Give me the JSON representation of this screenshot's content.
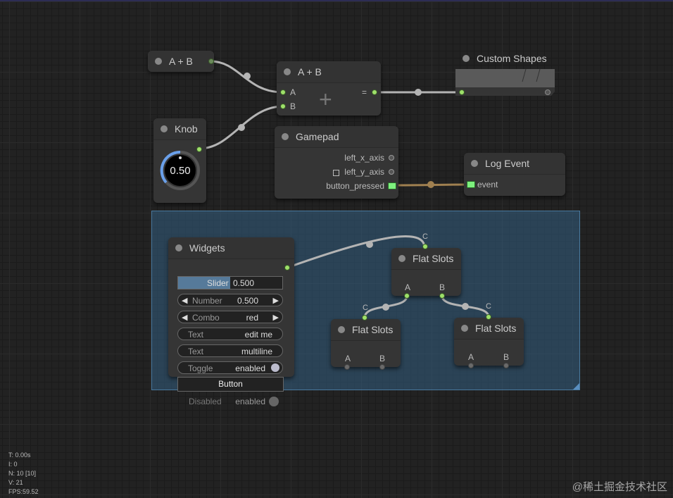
{
  "nodes": {
    "sum_collapsed": {
      "title": "A + B"
    },
    "sum": {
      "title": "A + B",
      "input_a": "A",
      "input_b": "B",
      "output": "=",
      "symbol": "+"
    },
    "custom_shapes": {
      "title": "Custom Shapes"
    },
    "knob": {
      "title": "Knob",
      "value": "0.50"
    },
    "gamepad": {
      "title": "Gamepad",
      "outputs": [
        "left_x_axis",
        "left_y_axis",
        "button_pressed"
      ]
    },
    "log_event": {
      "title": "Log Event",
      "input": "event"
    },
    "widgets": {
      "title": "Widgets",
      "slider": {
        "label": "Slider",
        "value": "0.500"
      },
      "number": {
        "label": "Number",
        "value": "0.500"
      },
      "combo": {
        "label": "Combo",
        "value": "red"
      },
      "text1": {
        "label": "Text",
        "value": "edit me"
      },
      "text2": {
        "label": "Text",
        "value": "multiline"
      },
      "toggle": {
        "label": "Toggle",
        "value": "enabled"
      },
      "button": {
        "label": "Button"
      },
      "disabled": {
        "label": "Disabled",
        "value": "enabled"
      }
    },
    "flat_top": {
      "title": "Flat Slots",
      "in_c": "C",
      "out_a": "A",
      "out_b": "B"
    },
    "flat_left": {
      "title": "Flat Slots",
      "in_c": "C",
      "out_a": "A",
      "out_b": "B"
    },
    "flat_right": {
      "title": "Flat Slots",
      "in_c": "C",
      "out_a": "A",
      "out_b": "B"
    }
  },
  "arrows": {
    "left": "◀",
    "right": "▶"
  },
  "stats": {
    "t": "T: 0.00s",
    "i": "I: 0",
    "n": "N: 10 [10]",
    "v": "V: 21",
    "fps": "FPS:59.52"
  },
  "watermark": "@稀土掘金技术社区",
  "colors": {
    "slot_active": "#9ee06a",
    "group_bg": "#335f82",
    "link": "#b4b4b4",
    "event_link": "#a08050"
  }
}
